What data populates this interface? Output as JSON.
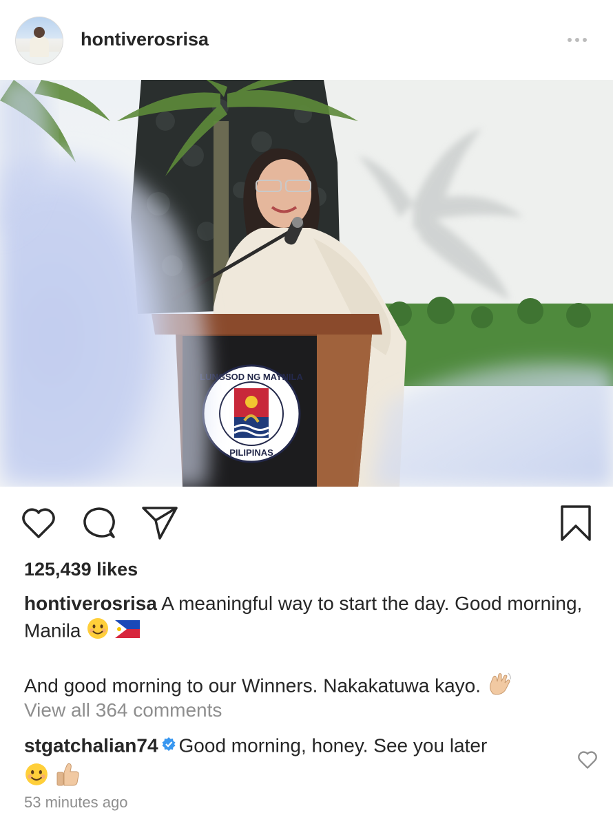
{
  "post": {
    "username": "hontiverosrisa",
    "likes_text": "125,439 likes",
    "caption": {
      "author": "hontiverosrisa",
      "line1": "A meaningful way to start the day. Good morning, Manila",
      "line2": "And good morning to our Winners. Nakakatuwa kayo."
    },
    "view_all_comments": "View all 364 comments",
    "comment": {
      "author": "stgatchalian74",
      "text": "Good morning, honey. See you later"
    },
    "timestamp": "53 minutes ago",
    "podium_seal": {
      "top_text": "LUNGSOD NG MAYNILA",
      "bottom_text": "PILIPINAS"
    }
  },
  "icons": [
    "avatar",
    "more-icon",
    "heart-icon",
    "comment-icon",
    "share-icon",
    "bookmark-icon",
    "verified-icon",
    "smile-emoji",
    "ph-flag-emoji",
    "wave-emoji",
    "thumbs-up-emoji",
    "comment-heart-icon"
  ],
  "colors": {
    "text": "#262626",
    "secondary": "#8e8e8e",
    "verified": "#3897f0"
  }
}
